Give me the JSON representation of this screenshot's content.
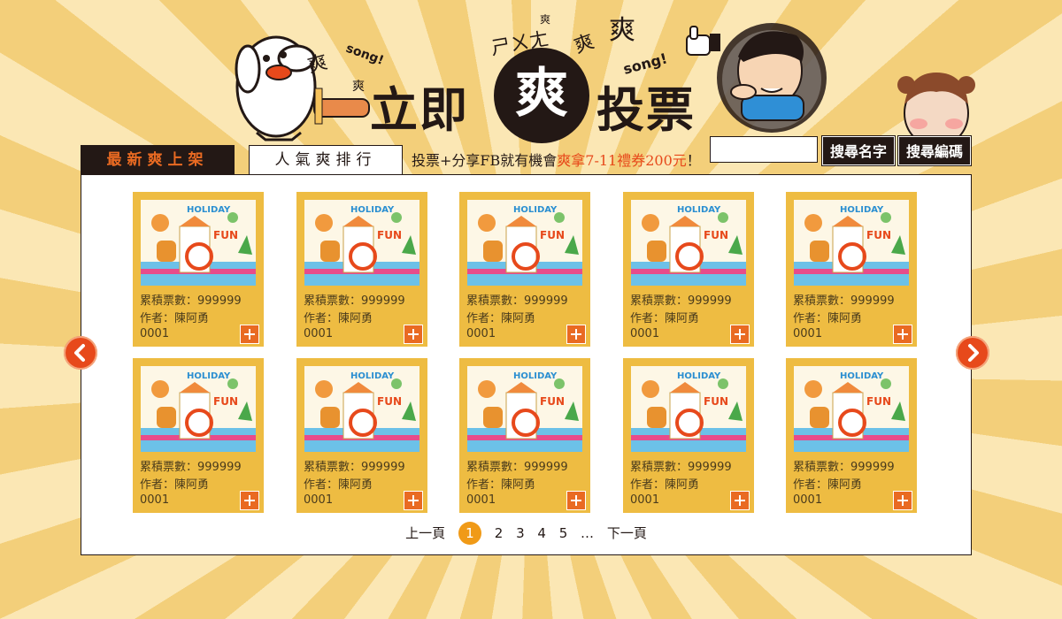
{
  "header": {
    "title_left": "立即",
    "title_mid": "爽",
    "title_right": "投票",
    "deco_song1": "song!",
    "deco_song2": "song!",
    "deco_shuang": "爽"
  },
  "tabs": [
    {
      "label": "最新爽上架",
      "active": true
    },
    {
      "label": "人氣爽排行",
      "active": false
    }
  ],
  "promo": {
    "prefix": "投票+分享FB就有機會",
    "highlight": "爽拿7-11禮券200元",
    "suffix": "！"
  },
  "search": {
    "value": "",
    "placeholder": "",
    "by_name_label": "搜尋名字",
    "by_code_label": "搜尋編碼"
  },
  "cards": [
    {
      "votes_label": "累積票數：999999",
      "author_label": "作者：陳阿勇",
      "code": "0001",
      "thumb_title": "HOLIDAY",
      "thumb_fun": "FUN"
    },
    {
      "votes_label": "累積票數：999999",
      "author_label": "作者：陳阿勇",
      "code": "0001",
      "thumb_title": "HOLIDAY",
      "thumb_fun": "FUN"
    },
    {
      "votes_label": "累積票數：999999",
      "author_label": "作者：陳阿勇",
      "code": "0001",
      "thumb_title": "HOLIDAY",
      "thumb_fun": "FUN"
    },
    {
      "votes_label": "累積票數：999999",
      "author_label": "作者：陳阿勇",
      "code": "0001",
      "thumb_title": "HOLIDAY",
      "thumb_fun": "FUN"
    },
    {
      "votes_label": "累積票數：999999",
      "author_label": "作者：陳阿勇",
      "code": "0001",
      "thumb_title": "HOLIDAY",
      "thumb_fun": "FUN"
    },
    {
      "votes_label": "累積票數：999999",
      "author_label": "作者：陳阿勇",
      "code": "0001",
      "thumb_title": "HOLIDAY",
      "thumb_fun": "FUN"
    },
    {
      "votes_label": "累積票數：999999",
      "author_label": "作者：陳阿勇",
      "code": "0001",
      "thumb_title": "HOLIDAY",
      "thumb_fun": "FUN"
    },
    {
      "votes_label": "累積票數：999999",
      "author_label": "作者：陳阿勇",
      "code": "0001",
      "thumb_title": "HOLIDAY",
      "thumb_fun": "FUN"
    },
    {
      "votes_label": "累積票數：999999",
      "author_label": "作者：陳阿勇",
      "code": "0001",
      "thumb_title": "HOLIDAY",
      "thumb_fun": "FUN"
    },
    {
      "votes_label": "累積票數：999999",
      "author_label": "作者：陳阿勇",
      "code": "0001",
      "thumb_title": "HOLIDAY",
      "thumb_fun": "FUN"
    }
  ],
  "pager": {
    "prev": "上一頁",
    "pages": [
      "1",
      "2",
      "3",
      "4",
      "5"
    ],
    "current": "1",
    "ellipsis": "…",
    "next": "下一頁"
  },
  "colors": {
    "accent": "#e96a22",
    "card_bg": "#eebc42",
    "dark": "#231815",
    "page_current": "#f09a17"
  }
}
